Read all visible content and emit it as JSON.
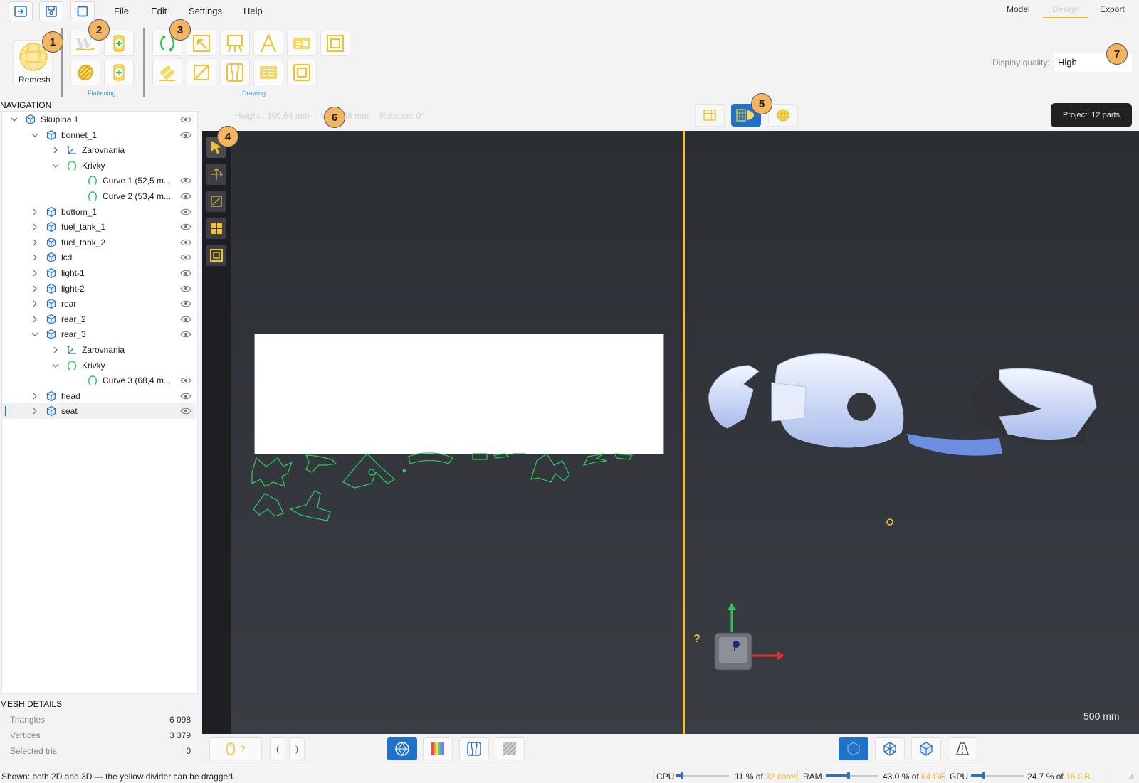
{
  "menu": {
    "items": [
      "File",
      "Edit",
      "Settings",
      "Help"
    ]
  },
  "mode_tabs": {
    "model": "Model",
    "design": "Design",
    "export": "Export",
    "active": "Design"
  },
  "ribbon": {
    "remesh_label": "Remesh",
    "flattening_group": "Flattening",
    "drawing_group": "Drawing"
  },
  "badges": [
    "1",
    "2",
    "3",
    "4",
    "5",
    "6",
    "7"
  ],
  "display_quality": {
    "label": "Display quality:",
    "value": "High"
  },
  "navigation": {
    "title": "NAVIGATION",
    "tree": [
      {
        "label": "Skupina 1",
        "kind": "group",
        "expanded": true
      },
      {
        "label": "bonnet_1",
        "kind": "mesh",
        "expanded": true
      },
      {
        "label": "Zarovnania",
        "kind": "align",
        "expanded": false
      },
      {
        "label": "Krivky",
        "kind": "curves",
        "expanded": true
      },
      {
        "label": "Curve 1  (52,5 m...",
        "kind": "curve"
      },
      {
        "label": "Curve 2  (53,4 m...",
        "kind": "curve"
      },
      {
        "label": "bottom_1",
        "kind": "mesh",
        "expanded": false
      },
      {
        "label": "fuel_tank_1",
        "kind": "mesh",
        "expanded": false
      },
      {
        "label": "fuel_tank_2",
        "kind": "mesh",
        "expanded": false
      },
      {
        "label": "lcd",
        "kind": "mesh",
        "expanded": false
      },
      {
        "label": "light-1",
        "kind": "mesh",
        "expanded": false
      },
      {
        "label": "light-2",
        "kind": "mesh",
        "expanded": false
      },
      {
        "label": "rear",
        "kind": "mesh",
        "expanded": false
      },
      {
        "label": "rear_2",
        "kind": "mesh",
        "expanded": false
      },
      {
        "label": "rear_3",
        "kind": "mesh",
        "expanded": true
      },
      {
        "label": "Zarovnania",
        "kind": "align",
        "expanded": false
      },
      {
        "label": "Krivky",
        "kind": "curves",
        "expanded": true
      },
      {
        "label": "Curve 3  (68,4 m...",
        "kind": "curve"
      },
      {
        "label": "head",
        "kind": "mesh",
        "expanded": false
      },
      {
        "label": "seat",
        "kind": "mesh",
        "expanded": false,
        "selected": true
      }
    ]
  },
  "mesh_details": {
    "title": "MESH DETAILS",
    "rows": [
      {
        "label": "Triangles",
        "value": "6 098"
      },
      {
        "label": "Vertices",
        "value": "3 379"
      },
      {
        "label": "Selected tris",
        "value": "0"
      }
    ]
  },
  "viewport": {
    "info": {
      "height": "Height : 390,64 mm",
      "width": "W 61,68 mm",
      "rotation": "Rotation: 0°"
    },
    "project_pill": "Project: 12 parts",
    "scale": "500 mm",
    "help": "?"
  },
  "bottom": {
    "mouse_hint": "?",
    "bracket_left": "(",
    "bracket_right": ")"
  },
  "status": {
    "message": "Shown: both 2D and 3D — the yellow divider can be dragged.",
    "cpu": {
      "label": "CPU",
      "text": "11 % of ",
      "hl": "32 cores",
      "level": 0.11
    },
    "ram": {
      "label": "RAM",
      "text": "43.0 % of ",
      "hl": "64 GB",
      "level": 0.43
    },
    "gpu": {
      "label": "GPU",
      "text": "24.7 % of ",
      "hl": "16 GB",
      "level": 0.247
    }
  },
  "colors": {
    "accent": "#f1c230",
    "selection": "#1f72c9",
    "curve": "#2ec45a",
    "badge": "#f3b562"
  }
}
